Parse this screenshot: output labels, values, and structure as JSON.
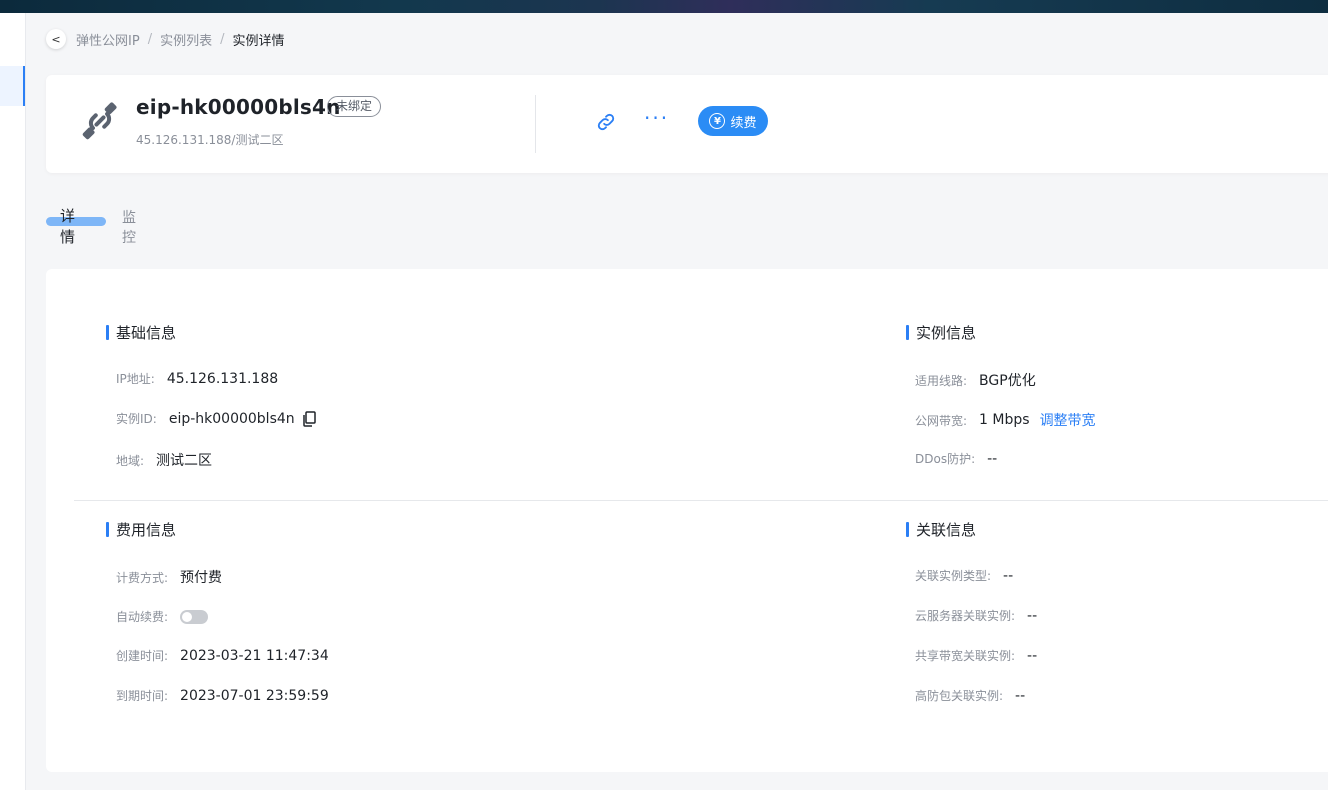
{
  "breadcrumb": {
    "back": "<",
    "items": [
      "弹性公网IP",
      "实例列表",
      "实例详情"
    ]
  },
  "header": {
    "title": "eip-hk00000bls4n",
    "status": "未绑定",
    "subtitle": "45.126.131.188/测试二区",
    "more": "···",
    "renew_label": "续费",
    "renew_icon": "¥"
  },
  "tabs": [
    {
      "label": "详情",
      "active": true
    },
    {
      "label": "监控",
      "active": false
    }
  ],
  "sections": {
    "basic": {
      "title": "基础信息",
      "rows": [
        {
          "label": "IP地址:",
          "value": "45.126.131.188"
        },
        {
          "label": "实例ID:",
          "value": "eip-hk00000bls4n"
        },
        {
          "label": "地域:",
          "value": "测试二区"
        }
      ]
    },
    "instance": {
      "title": "实例信息",
      "rows": [
        {
          "label": "适用线路:",
          "value": "BGP优化"
        },
        {
          "label": "公网带宽:",
          "value": "1 Mbps",
          "action": "调整带宽"
        },
        {
          "label": "DDos防护:",
          "value": "--"
        }
      ]
    },
    "billing": {
      "title": "费用信息",
      "rows": [
        {
          "label": "计费方式:",
          "value": "预付费"
        },
        {
          "label": "自动续费:",
          "value": ""
        },
        {
          "label": "创建时间:",
          "value": "2023-03-21 11:47:34"
        },
        {
          "label": "到期时间:",
          "value": "2023-07-01 23:59:59"
        }
      ],
      "auto_renew": false
    },
    "association": {
      "title": "关联信息",
      "rows": [
        {
          "label": "关联实例类型:",
          "value": "--"
        },
        {
          "label": "云服务器关联实例:",
          "value": "--"
        },
        {
          "label": "共享带宽关联实例:",
          "value": "--"
        },
        {
          "label": "高防包关联实例:",
          "value": "--"
        }
      ]
    }
  },
  "colors": {
    "accent": "#2b7ff5",
    "renew_button": "#2b8cf5",
    "tab_highlight": "#7eb6f7"
  }
}
